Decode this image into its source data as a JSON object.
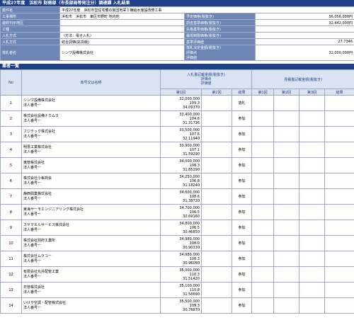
{
  "title": "平成27年度　浜松市 財務部（市長部局等発注分）調達課 入札結果",
  "info_rows": [
    {
      "label": "案件名",
      "value": "平成27年度　浜松市営住宅鷺の宮団地栄１棟給水施設改修工事",
      "full": true
    },
    {
      "label": "工事場所",
      "value": "浜松市　浜松市　東区市野町 地内他",
      "label2": "予定価格(税抜き)",
      "value2": "36,056,000円"
    },
    {
      "label": "最終刊示地区",
      "value": "",
      "label2": "調査基準価格(税抜き)",
      "value2": "32,442,000円"
    },
    {
      "label": "工種",
      "value": "",
      "label2": "失格基準価格(税抜き)",
      "value2": ""
    },
    {
      "label": "入札方式",
      "value": "（方法：電子入札）",
      "label2": "最低制限価格(税抜き)",
      "value2": ""
    },
    {
      "label": "入札方式",
      "value": "総合評価(拡充版)",
      "label2": "基準評価値",
      "value2": "27.7346"
    },
    {
      "label": "落札者名",
      "value": "シンワ設備株式会社",
      "label2": "落札決定金額(税抜き)\n評価点\n評価値",
      "value2": "32,000,000円"
    }
  ],
  "list_title": "業者一覧",
  "headers": {
    "no": "No",
    "name": "商号又は名称",
    "bid_group": "入札書記載金額(税抜き)\n評価点\n評価値",
    "bid_group_lines": [
      "入札書記載金額(税抜き)",
      "評価点",
      "評価値"
    ],
    "estimate_group": "見積書記載金額(税抜き)",
    "r1": "第1回",
    "r2": "第2回",
    "result": "結果",
    "e1": "第1回",
    "e2": "第2回",
    "e3": "第3回",
    "eresult": "結果"
  },
  "bidders": [
    {
      "no": "1",
      "name": "シンワ設備株式会社",
      "sub": "法人番号ー",
      "amount": "32,000,000",
      "score": "109.3",
      "value": "34.09370",
      "result": "落札"
    },
    {
      "no": "2",
      "name": "株式会社設備ナカムラ",
      "sub": "法人番号ー",
      "amount": "33,400,000",
      "score": "104.6",
      "value": "31.31736",
      "result": "参加"
    },
    {
      "no": "3",
      "name": "フジテック株式会社",
      "sub": "法人番号ー",
      "amount": "33,500,000",
      "score": "107.6",
      "value": "32.11940",
      "result": "参加"
    },
    {
      "no": "4",
      "name": "明豊工業株式会社",
      "sub": "法人番号ー",
      "amount": "33,900,000",
      "score": "107.1",
      "value": "31.59290",
      "result": "参加"
    },
    {
      "no": "5",
      "name": "東管株式会社",
      "sub": "法人番号ー",
      "amount": "34,000,000",
      "score": "108.3",
      "value": "31.85290",
      "result": "参加"
    },
    {
      "no": "6",
      "name": "株式会社小峯商会",
      "sub": "法人番号ー",
      "amount": "34,250,000",
      "score": "106.8",
      "value": "31.18240",
      "result": "参加"
    },
    {
      "no": "7",
      "name": "静西興業株式会社",
      "sub": "法人番号ー",
      "amount": "34,600,000",
      "score": "108.6",
      "value": "31.38720",
      "result": "参加"
    },
    {
      "no": "8",
      "name": "東海サーモエンジニアリング株式会社",
      "sub": "法人番号ー",
      "amount": "34,700,000",
      "score": "106.5",
      "value": "30.69160",
      "result": "参加"
    },
    {
      "no": "9",
      "name": "スヤマビルサービス株式会社",
      "sub": "法人番号ー",
      "amount": "34,800,000",
      "score": "106.5",
      "value": "30.46850",
      "result": "参加"
    },
    {
      "no": "10",
      "name": "株式会社別府工業所",
      "sub": "法人番号ー",
      "amount": "34,980,000",
      "score": "108.0",
      "value": "30.90330",
      "result": "参加"
    },
    {
      "no": "11",
      "name": "株式会社ムラコー",
      "sub": "法人番号ー",
      "amount": "34,980,000",
      "score": "108.3",
      "value": "30.96050",
      "result": "参加"
    },
    {
      "no": "12",
      "name": "有限会社丸井配管工業",
      "sub": "法人番号ー",
      "amount": "35,000,000",
      "score": "110.3",
      "value": "31.51420",
      "result": "参加"
    },
    {
      "no": "13",
      "name": "日管株式会社",
      "sub": "法人番号ー",
      "amount": "35,100,000",
      "score": "110.8",
      "value": "31.56690",
      "result": "参加"
    },
    {
      "no": "14",
      "name": "いけや空調・配管株式会社",
      "sub": "法人番号ー",
      "amount": "35,500,000",
      "score": "109.3",
      "value": "30.78870",
      "result": "参加"
    }
  ]
}
